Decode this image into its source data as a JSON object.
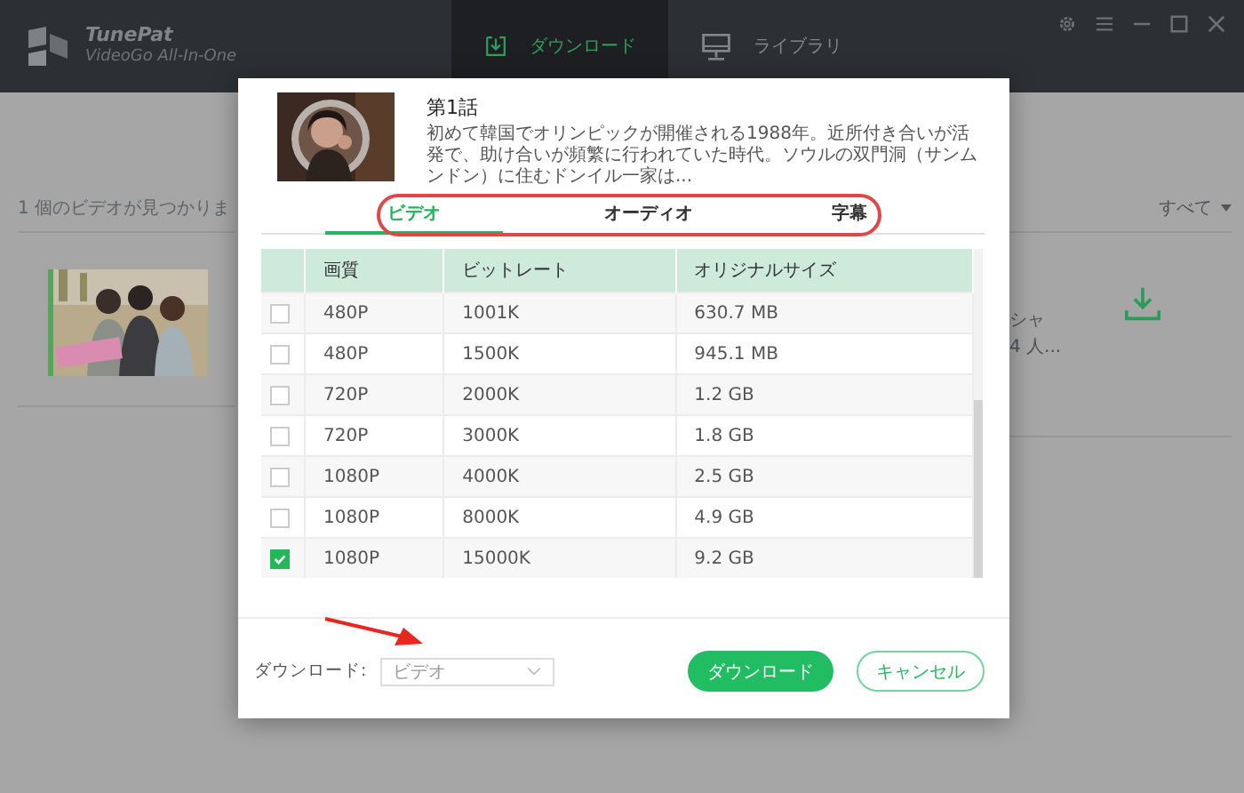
{
  "app": {
    "logo_title": "TunePat",
    "logo_subtitle": "VideoGo All-In-One"
  },
  "nav_tabs": [
    {
      "label": "ダウンロード",
      "selected": true
    },
    {
      "label": "ライブラリ",
      "selected": false
    }
  ],
  "background": {
    "found_text": "1 個のビデオが見つかりま",
    "filter": "すべて",
    "snippet_lines": [
      "シャ",
      "4 人..."
    ]
  },
  "dialog": {
    "episode_title": "第1話",
    "description": "初めて韓国でオリンピックが開催される1988年。近所付き合いが活発で、助け合いが頻繁に行われていた時代。ソウルの双門洞（サンムンドン）に住むドンイル一家は...",
    "tabs": [
      {
        "label": "ビデオ",
        "selected": true
      },
      {
        "label": "オーディオ",
        "selected": false
      },
      {
        "label": "字幕",
        "selected": false
      }
    ],
    "table": {
      "columns": [
        "画質",
        "ビットレート",
        "オリジナルサイズ"
      ],
      "rows": [
        {
          "checked": false,
          "cells": [
            "480P",
            "1001K",
            "630.7 MB"
          ]
        },
        {
          "checked": false,
          "cells": [
            "480P",
            "1500K",
            "945.1 MB"
          ]
        },
        {
          "checked": false,
          "cells": [
            "720P",
            "2000K",
            "1.2 GB"
          ]
        },
        {
          "checked": false,
          "cells": [
            "720P",
            "3000K",
            "1.8 GB"
          ]
        },
        {
          "checked": false,
          "cells": [
            "1080P",
            "4000K",
            "2.5 GB"
          ]
        },
        {
          "checked": false,
          "cells": [
            "1080P",
            "8000K",
            "4.9 GB"
          ]
        },
        {
          "checked": true,
          "cells": [
            "1080P",
            "15000K",
            "9.2 GB"
          ]
        }
      ]
    },
    "footer": {
      "label": "ダウンロード:",
      "select_value": "ビデオ",
      "primary_button": "ダウンロード",
      "cancel_button": "キャンセル"
    }
  }
}
